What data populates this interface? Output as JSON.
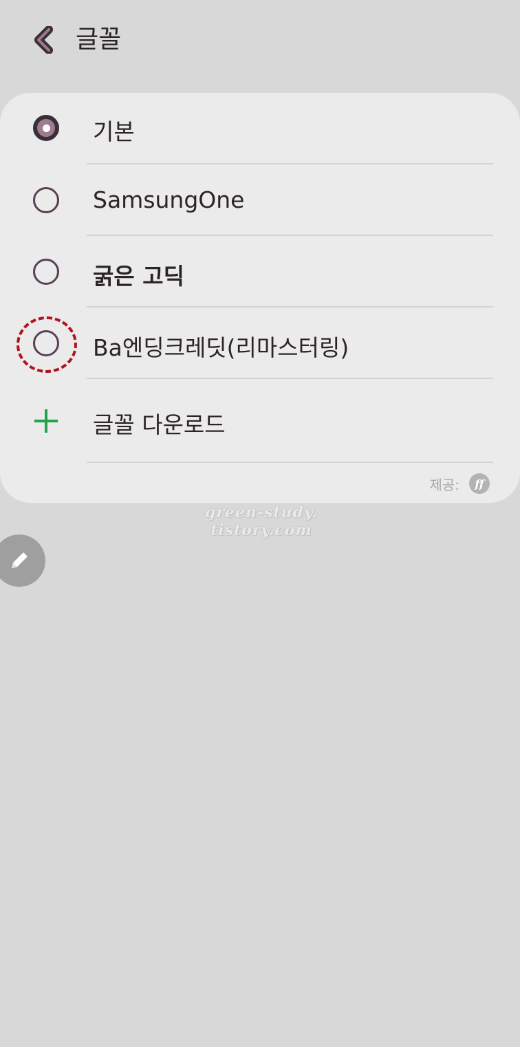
{
  "header": {
    "title": "글꼴"
  },
  "fonts": {
    "items": [
      {
        "label": "기본",
        "selected": true
      },
      {
        "label": "SamsungOne",
        "selected": false
      },
      {
        "label": "굵은 고딕",
        "selected": false
      },
      {
        "label": "Ba엔딩크레딧(리마스터링)",
        "selected": false
      }
    ],
    "download_label": "글꼴 다운로드"
  },
  "provider": {
    "label": "제공:",
    "logo_text": "ff"
  },
  "watermark": {
    "line1": "green-study.",
    "line2": "tistory.com"
  },
  "colors": {
    "background": "#d8d8d8",
    "card": "#ebebeb",
    "radio": "#5a3f53",
    "plus": "#1fa44a",
    "highlight": "#b1131d"
  },
  "icons": {
    "back": "chevron-left-icon",
    "add": "plus-icon",
    "fab": "pencil-icon"
  }
}
